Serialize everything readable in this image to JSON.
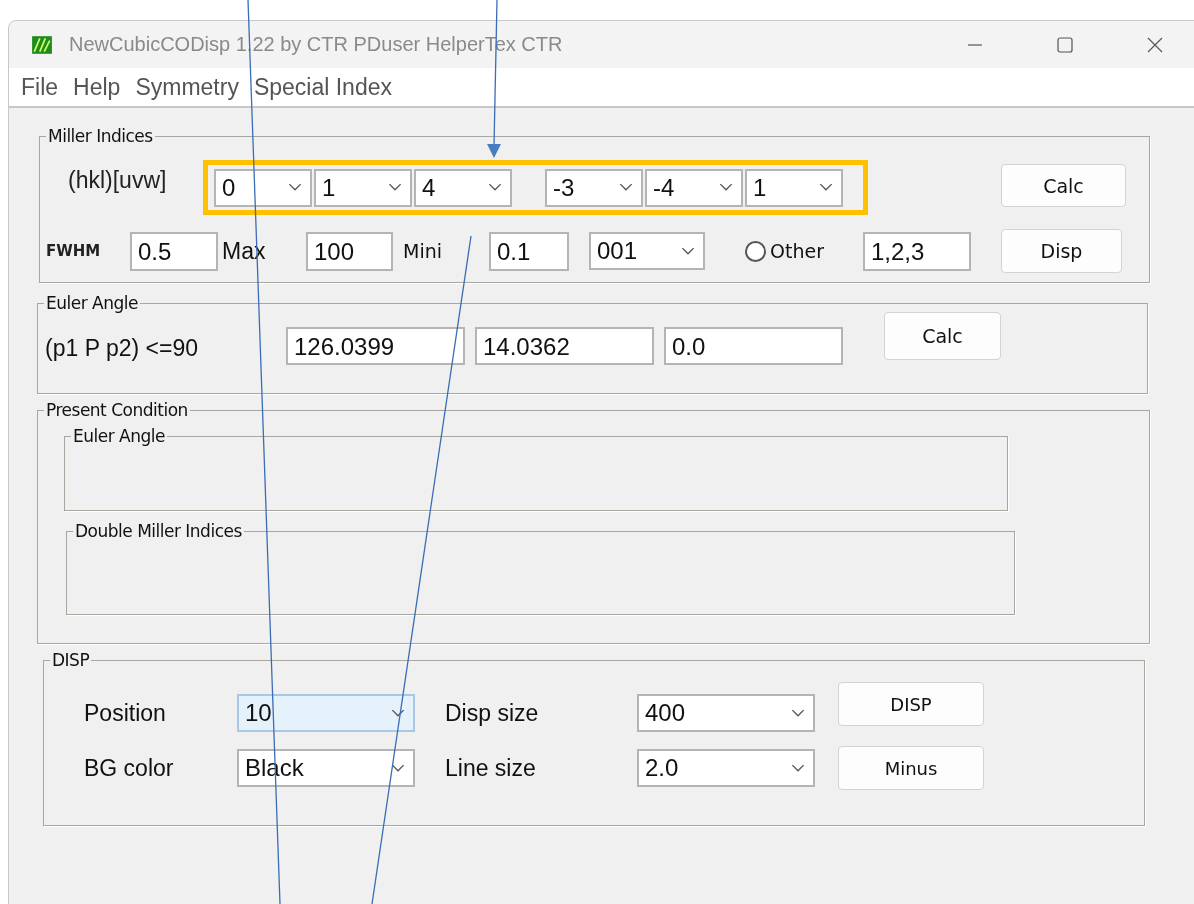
{
  "window": {
    "title": "NewCubicCODisp 1.22 by CTR PDuser HelperTex CTR"
  },
  "menu": [
    "File",
    "Help",
    "Symmetry",
    "Special Index"
  ],
  "miller": {
    "legend": "Miller Indices",
    "label": "(hkl)[uvw]",
    "hkl": [
      "0",
      "1",
      "4"
    ],
    "uvw": [
      "-3",
      "-4",
      "1"
    ],
    "calc_button": "Calc",
    "fwhm_label": "FWHM",
    "fwhm": "0.5",
    "max_label": "Max",
    "max": "100",
    "mini_label": "Mini",
    "mini": "0.1",
    "direction": "001",
    "other": {
      "label": "Other",
      "checked": false
    },
    "other_value": "1,2,3",
    "disp_button": "Disp"
  },
  "euler": {
    "legend": "Euler Angle",
    "label": "(p1 P p2) <=90",
    "values": [
      "126.0399",
      "14.0362",
      "0.0"
    ],
    "calc_button": "Calc"
  },
  "present": {
    "legend": "Present Condition",
    "groups": [
      "Euler Angle",
      "Double Miller Indices"
    ]
  },
  "disp": {
    "legend": "DISP",
    "rows": [
      {
        "label": "Position",
        "value": "10",
        "focused": true,
        "label2": "Disp size",
        "value2": "400",
        "button": "DISP"
      },
      {
        "label": "BG color",
        "value": "Black",
        "focused": false,
        "label2": "Line size",
        "value2": "2.0",
        "button": "Minus"
      }
    ]
  }
}
